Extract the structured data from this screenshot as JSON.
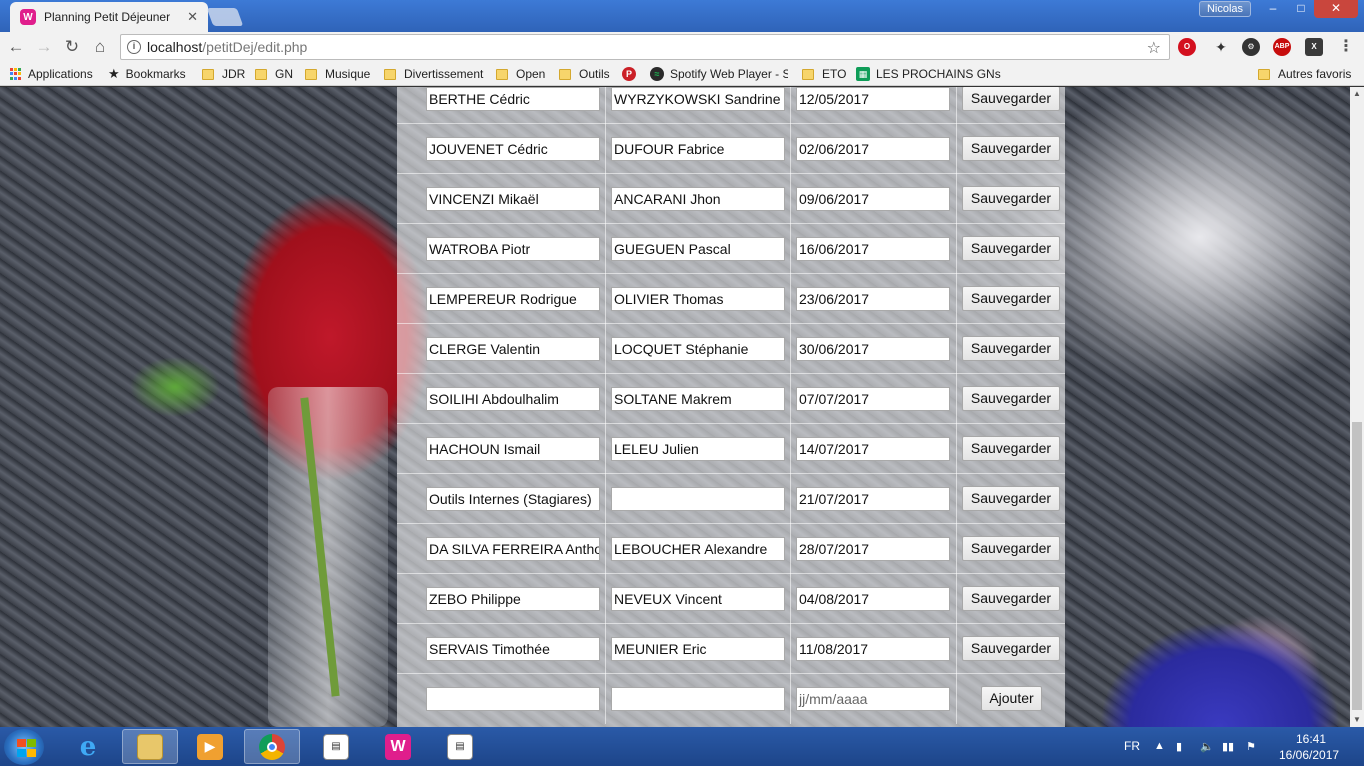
{
  "browser": {
    "tab_title": "Planning Petit Déjeuner",
    "tab_favicon": "W",
    "tab_close": "✕",
    "user": "Nicolas",
    "url_host": "localhost",
    "url_path": "/petitDej/edit.php"
  },
  "bookmarks": [
    {
      "label": "Applications",
      "icon": "apps-grid-icon"
    },
    {
      "label": "Bookmarks",
      "icon": "star-icon"
    },
    {
      "label": "JDR",
      "icon": "folder-icon"
    },
    {
      "label": "GN",
      "icon": "folder-icon"
    },
    {
      "label": "Musique",
      "icon": "folder-icon"
    },
    {
      "label": "Divertissement",
      "icon": "folder-icon"
    },
    {
      "label": "Open",
      "icon": "folder-icon"
    },
    {
      "label": "Outils",
      "icon": "folder-icon"
    },
    {
      "label": "",
      "icon": "pinterest-icon"
    },
    {
      "label": "Spotify Web Player - S",
      "icon": "spotify-icon"
    },
    {
      "label": "ETO",
      "icon": "folder-icon"
    },
    {
      "label": "LES PROCHAINS GNs",
      "icon": "sheets-icon"
    },
    {
      "label": "Autres favoris",
      "icon": "folder-icon"
    }
  ],
  "extensions": {
    "abp": "ABP",
    "x": "X"
  },
  "planning": {
    "save_label": "Sauvegarder",
    "add_label": "Ajouter",
    "date_placeholder": "jj/mm/aaaa",
    "rows": [
      {
        "person1": "BERTHE Cédric",
        "person2": "WYRZYKOWSKI Sandrine",
        "date": "12/05/2017"
      },
      {
        "person1": "JOUVENET Cédric",
        "person2": "DUFOUR Fabrice",
        "date": "02/06/2017"
      },
      {
        "person1": "VINCENZI Mikaël",
        "person2": "ANCARANI Jhon",
        "date": "09/06/2017"
      },
      {
        "person1": "WATROBA Piotr",
        "person2": "GUEGUEN Pascal",
        "date": "16/06/2017"
      },
      {
        "person1": "LEMPEREUR Rodrigue",
        "person2": "OLIVIER Thomas",
        "date": "23/06/2017"
      },
      {
        "person1": "CLERGE Valentin",
        "person2": "LOCQUET Stéphanie",
        "date": "30/06/2017"
      },
      {
        "person1": "SOILIHI Abdoulhalim",
        "person2": "SOLTANE Makrem",
        "date": "07/07/2017"
      },
      {
        "person1": "HACHOUN Ismail",
        "person2": "LELEU Julien",
        "date": "14/07/2017"
      },
      {
        "person1": "Outils Internes (Stagiares)",
        "person2": "",
        "date": "21/07/2017"
      },
      {
        "person1": "DA SILVA FERREIRA Anthony",
        "person2": "LEBOUCHER Alexandre",
        "date": "28/07/2017"
      },
      {
        "person1": "ZEBO Philippe",
        "person2": "NEVEUX Vincent",
        "date": "04/08/2017"
      },
      {
        "person1": "SERVAIS Timothée",
        "person2": "MEUNIER Eric",
        "date": "11/08/2017"
      }
    ]
  },
  "taskbar": {
    "lang": "FR",
    "time": "16:41",
    "date": "16/06/2017"
  }
}
